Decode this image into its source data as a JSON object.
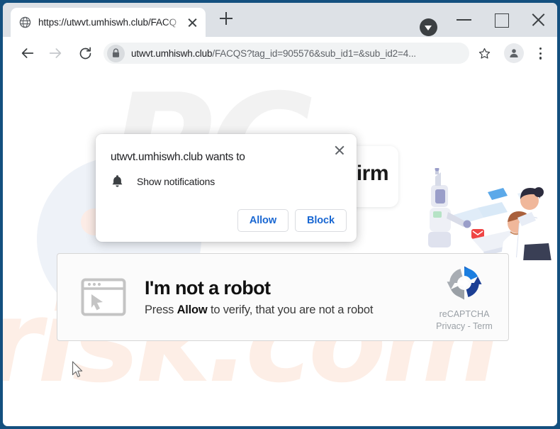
{
  "window": {
    "controls": {
      "tab_dropdown": "tab-search-dropdown",
      "minimize": "minimize",
      "maximize": "maximize",
      "close": "close"
    }
  },
  "tabstrip": {
    "tab": {
      "favicon": "globe-icon",
      "title": "https://utwvt.umhiswh.club/FACQ",
      "close": "close-tab-icon"
    },
    "new_tab": "new-tab-plus-icon"
  },
  "toolbar": {
    "back": "back-arrow-icon",
    "forward": "forward-arrow-icon",
    "reload": "reload-icon",
    "lock": "lock-icon",
    "url_host": "utwvt.umhiswh.club",
    "url_path": "/FACQS?tag_id=905576&sub_id1=&sub_id2=4...",
    "bookmark": "star-icon",
    "profile": "profile-avatar-icon",
    "menu": "three-dot-menu-icon"
  },
  "permission_bubble": {
    "title": "utwvt.umhiswh.club wants to",
    "close": "close-icon",
    "request_icon": "bell-icon",
    "request_label": "Show notifications",
    "allow_label": "Allow",
    "block_label": "Block",
    "accent_color": "#1967d2"
  },
  "page": {
    "hero_title_visible": "irm",
    "watermark_top": "PC",
    "watermark_bottom": "risk.com",
    "illustration": "robot-and-people-illustration",
    "captcha": {
      "window_icon": "browser-window-cursor-icon",
      "heading": "I'm not a robot",
      "subtext_prefix": "Press ",
      "subtext_bold": "Allow",
      "subtext_suffix": " to verify, that you are not a robot",
      "brand_icon": "recaptcha-logo-icon",
      "brand_name": "reCAPTCHA",
      "brand_links": "Privacy - Term"
    },
    "cursor": "mouse-pointer-icon"
  },
  "colors": {
    "frame": "#14507f",
    "tabstrip": "#dde1e6",
    "omnibox": "#f1f3f4",
    "link_blue": "#1967d2",
    "watermark_peach": "#fdeee6",
    "watermark_gray": "#f2f2f2"
  }
}
